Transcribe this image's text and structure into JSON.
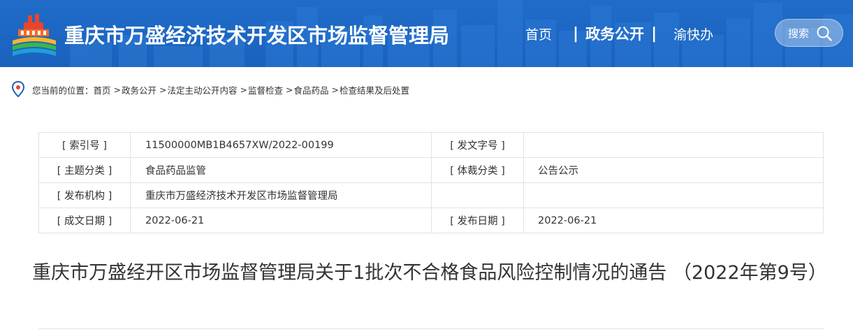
{
  "header": {
    "site_title": "重庆市万盛经济技术开发区市场监督管理局",
    "nav": {
      "home": "首页",
      "gov_affairs": "政务公开",
      "separator": "|",
      "yukuaiban": "渝快办"
    },
    "search_label": "搜索",
    "colors": {
      "background": "#1a62bd",
      "text": "#ffffff"
    }
  },
  "breadcrumb": {
    "prefix": "您当前的位置：",
    "separator": ">",
    "items": [
      "首页",
      "政务公开",
      "法定主动公开内容",
      "监督检查",
      "食品药品",
      "检查结果及后处置"
    ]
  },
  "info": {
    "index_no_label": "[ 索引号 ]",
    "index_no": "11500000MB1B4657XW/2022-00199",
    "doc_no_label": "[ 发文字号 ]",
    "doc_no": "",
    "topic_label": "[ 主题分类 ]",
    "topic": "食品药品监管",
    "genre_label": "[ 体裁分类 ]",
    "genre": "公告公示",
    "issuer_label": "[ 发布机构 ]",
    "issuer": "重庆市万盛经济技术开发区市场监督管理局",
    "created_label": "[ 成文日期 ]",
    "created_date": "2022-06-21",
    "published_label": "[ 发布日期 ]",
    "published_date": "2022-06-21"
  },
  "document": {
    "title": "重庆市万盛经开区市场监督管理局关于1批次不合格食品风险控制情况的通告 （2022年第9号）"
  }
}
